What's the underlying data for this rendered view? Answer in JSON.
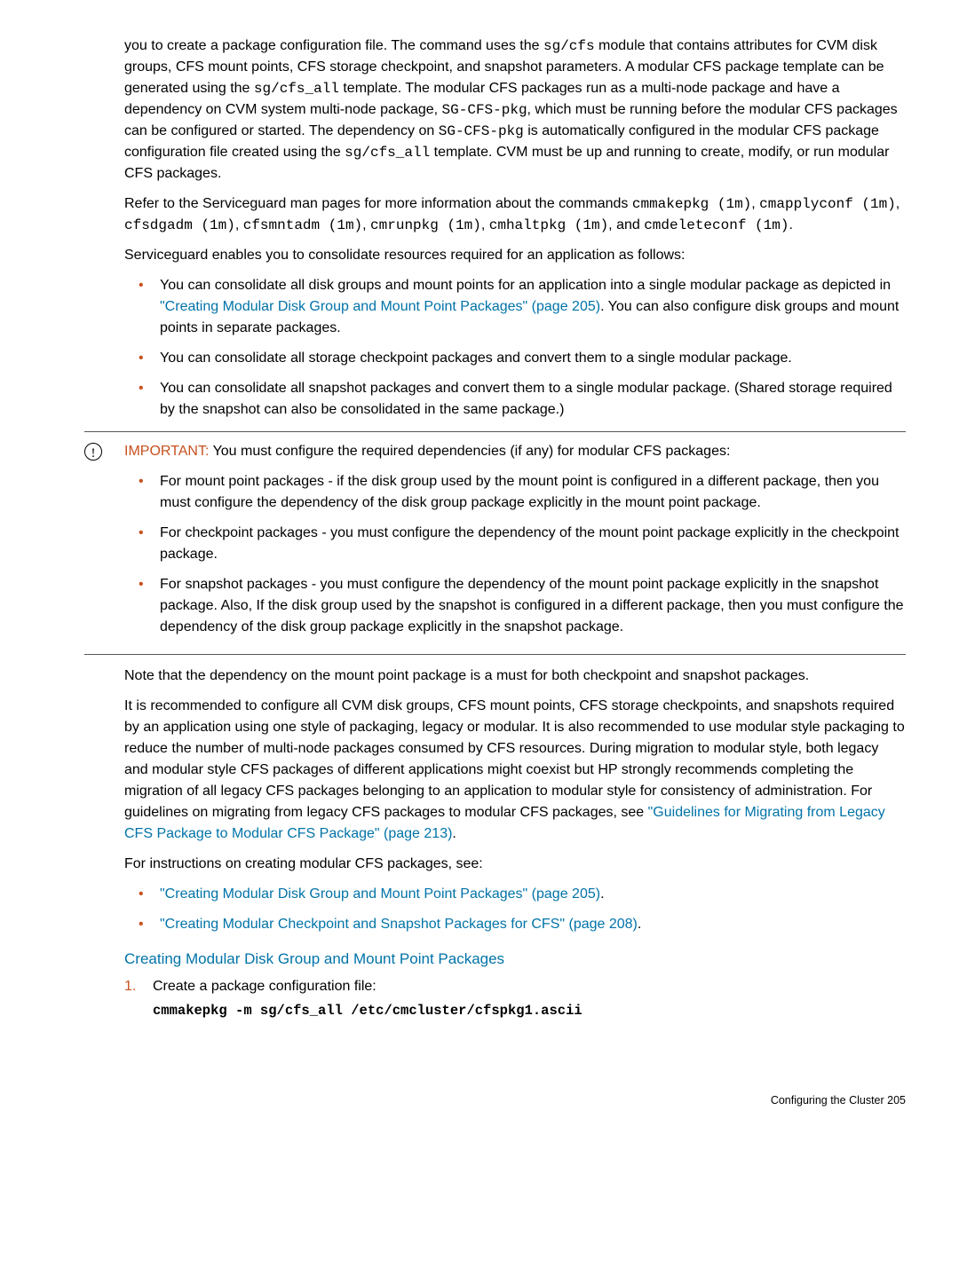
{
  "p1_a": "you to create a package configuration file. The command uses the ",
  "p1_code1": "sg/cfs",
  "p1_b": " module that contains attributes for CVM disk groups, CFS mount points, CFS storage checkpoint, and snapshot parameters. A modular CFS package template can be generated using the ",
  "p1_code2": "sg/cfs_all",
  "p1_c": " template. The modular CFS packages run as a multi-node package and have a dependency on CVM system multi-node package, ",
  "p1_code3": "SG-CFS-pkg",
  "p1_d": ", which must be running before the modular CFS packages can be configured or started. The dependency on ",
  "p1_code4": "SG-CFS-pkg",
  "p1_e": " is automatically configured in the modular CFS package configuration file created using the ",
  "p1_code5": "sg/cfs_all",
  "p1_f": " template. CVM must be up and running to create, modify, or run modular CFS packages.",
  "p2_a": "Refer to the Serviceguard man pages for more information about the commands ",
  "p2_code1": "cmmakepkg (1m)",
  "p2_s1": ", ",
  "p2_code2": "cmapplyconf (1m)",
  "p2_s2": ", ",
  "p2_code3": "cfsdgadm (1m)",
  "p2_s3": ", ",
  "p2_code4": "cfsmntadm (1m)",
  "p2_s4": ", ",
  "p2_code5": "cmrunpkg (1m)",
  "p2_s5": ", ",
  "p2_code6": "cmhaltpkg (1m)",
  "p2_b": ", and ",
  "p2_code7": "cmdeleteconf (1m)",
  "p2_c": ".",
  "p3": "Serviceguard enables you to consolidate resources required for an application as follows:",
  "ul1": {
    "i1_a": "You can consolidate all disk groups and mount points for an application into a single modular package as depicted in ",
    "i1_link": "\"Creating Modular Disk Group and Mount Point Packages\" (page 205)",
    "i1_b": ". You can also configure disk groups and mount points in separate packages.",
    "i2": "You can consolidate all storage checkpoint packages and convert them to a single modular package.",
    "i3": "You can consolidate all snapshot packages and convert them to a single modular package. (Shared storage required by the snapshot can also be consolidated in the same package.)"
  },
  "important": {
    "icon": "!",
    "label": "IMPORTANT:",
    "lead": "   You must configure the required dependencies (if any) for modular CFS packages:",
    "i1": "For mount point packages - if the disk group used by the mount point is configured in a different package, then you must configure the dependency of the disk group package explicitly in the mount point package.",
    "i2": "For checkpoint packages - you must configure the dependency of the mount point package explicitly in the checkpoint package.",
    "i3": "For snapshot packages - you must configure the dependency of the mount point package explicitly in the snapshot package. Also, If the disk group used by the snapshot is configured in a different package, then you must configure the dependency of the disk group package explicitly in the snapshot package."
  },
  "p4": "Note that the dependency on the mount point package is a must for both checkpoint and snapshot packages.",
  "p5_a": "It is recommended to configure all CVM disk groups, CFS mount points, CFS storage checkpoints, and snapshots required by an application using one style of packaging, legacy or modular. It is also recommended to use modular style packaging to reduce the number of multi-node packages consumed by CFS resources. During migration to modular style, both legacy and modular style CFS packages of different applications might coexist but HP strongly recommends completing the migration of all legacy CFS packages belonging to an application to modular style for consistency of administration. For guidelines on migrating from legacy CFS packages to modular CFS packages, see ",
  "p5_link": "\"Guidelines for Migrating from Legacy CFS Package to Modular CFS Package\" (page 213)",
  "p5_b": ".",
  "p6": "For instructions on creating modular CFS packages, see:",
  "ul2": {
    "i1_link": "\"Creating Modular Disk Group and Mount Point Packages\" (page 205)",
    "i1_b": ".",
    "i2_link": "\"Creating Modular Checkpoint and Snapshot Packages for CFS\" (page 208)",
    "i2_b": "."
  },
  "heading": "Creating Modular Disk Group and Mount Point Packages",
  "step1_text": "Create a package configuration file:",
  "step1_code": "cmmakepkg -m sg/cfs_all /etc/cmcluster/cfspkg1.ascii",
  "footer": "Configuring the Cluster   205"
}
